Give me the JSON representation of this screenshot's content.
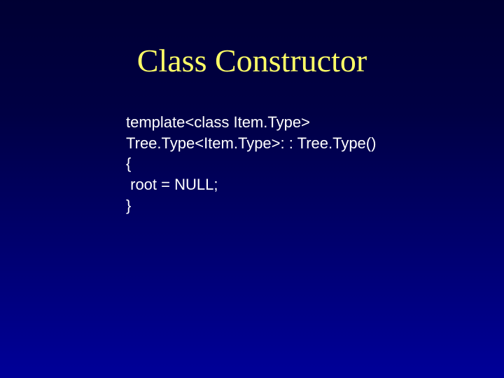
{
  "slide": {
    "title": "Class Constructor",
    "code": {
      "line1": "template<class Item.Type>",
      "line2": "Tree.Type<Item.Type>: : Tree.Type()",
      "line3": "{",
      "line4": " root = NULL;",
      "line5": "}"
    }
  }
}
